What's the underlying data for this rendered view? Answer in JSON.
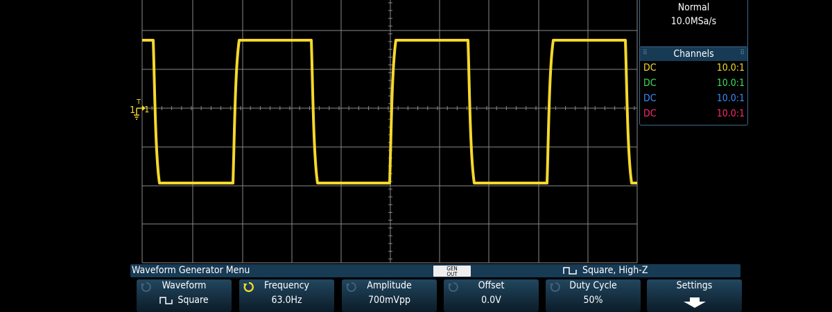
{
  "acquisition": {
    "mode": "Normal",
    "sample_rate": "10.0MSa/s"
  },
  "channels": {
    "title": "Channels",
    "rows": [
      {
        "coupling": "DC",
        "probe": "10.0:1",
        "color": "#f7dc2b"
      },
      {
        "coupling": "DC",
        "probe": "10.0:1",
        "color": "#3ee05a"
      },
      {
        "coupling": "DC",
        "probe": "10.0:1",
        "color": "#3d8cff"
      },
      {
        "coupling": "DC",
        "probe": "10.0:1",
        "color": "#ff2b6e"
      }
    ]
  },
  "trace": {
    "channel_marker": "1",
    "trigger_marker": "T",
    "color": "#f5d82b"
  },
  "menu": {
    "title": "Waveform Generator Menu",
    "gen_out_line1": "GEN",
    "gen_out_line2": "OUT",
    "status": "Square, High-Z"
  },
  "softkeys": [
    {
      "label": "Waveform",
      "value": "Square",
      "knob": "inactive",
      "value_icon": "square-wave-icon"
    },
    {
      "label": "Frequency",
      "value": "63.0Hz",
      "knob": "active"
    },
    {
      "label": "Amplitude",
      "value": "700mVpp",
      "knob": "inactive"
    },
    {
      "label": "Offset",
      "value": "0.0V",
      "knob": "inactive"
    },
    {
      "label": "Duty Cycle",
      "value": "50%",
      "knob": "inactive"
    },
    {
      "label": "Settings",
      "value": "",
      "icon": "down-arrow-icon"
    }
  ],
  "colors": {
    "accent": "#173a55",
    "knob_active": "#f5d82b",
    "knob_inactive": "#41627a",
    "grid": "#8a8a8a"
  }
}
